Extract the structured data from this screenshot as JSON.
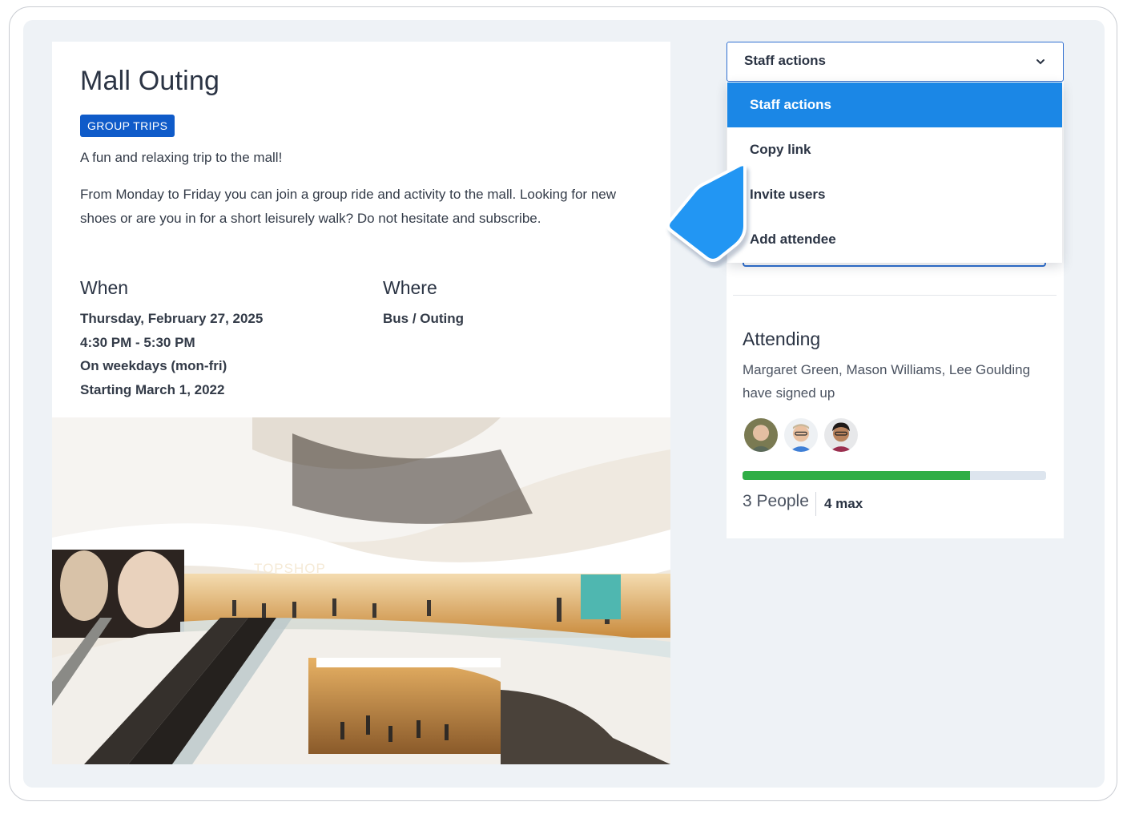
{
  "event": {
    "title": "Mall Outing",
    "category_badge": "GROUP TRIPS",
    "summary": "A fun and relaxing trip to the mall!",
    "description": "From Monday to Friday you can join a group ride and activity to the mall. Looking for new shoes or are you in for a short leisurely walk? Do not hesitate and subscribe.",
    "when": {
      "heading": "When",
      "date": "Thursday, February 27, 2025",
      "time": "4:30 PM - 5:30 PM",
      "recurrence": "On weekdays (mon-fri)",
      "start": "Starting March 1, 2022"
    },
    "where": {
      "heading": "Where",
      "location": "Bus / Outing"
    },
    "photo_store_sign": "TOPSHOP"
  },
  "actions": {
    "selected": "Staff actions",
    "options": [
      "Staff actions",
      "Copy link",
      "Invite users",
      "Add attendee"
    ]
  },
  "attending": {
    "heading": "Attending",
    "text": "Margaret Green, Mason Williams, Lee Goulding have signed up",
    "count_label": "3 People",
    "max_label": "4 max",
    "fill_fraction": 0.75
  },
  "colors": {
    "badge": "#0f5bc9",
    "menu_active": "#1b87e6",
    "progress_fill": "#2fae46",
    "cursor": "#2196f3"
  },
  "icons": {
    "select_chevron": "chevron-down-icon",
    "pointer": "cursor-pointer-icon"
  }
}
